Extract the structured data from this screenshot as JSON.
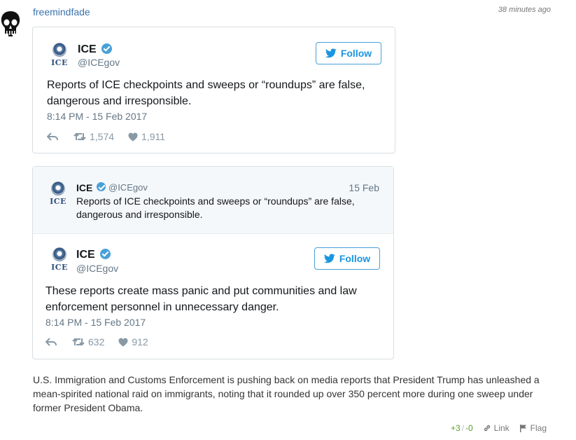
{
  "comment": {
    "username": "freemindfade",
    "timestamp": "38 minutes ago",
    "body": "U.S. Immigration and Customs Enforcement is pushing back on media reports that President Trump has unleashed a mean-spirited national raid on immigrants, noting that it rounded up over 350 percent more during one sweep under former President Obama.",
    "votes_up": "+3",
    "votes_sep": "/",
    "votes_down": "-0",
    "link_label": "Link",
    "flag_label": "Flag"
  },
  "tweet1": {
    "seal_label": "ICE",
    "name": "ICE",
    "handle": "@ICEgov",
    "follow_label": "Follow",
    "text": "Reports of ICE checkpoints and sweeps or “roundups” are false, dangerous and irresponsible.",
    "time": "8:14 PM - 15 Feb 2017",
    "retweets": "1,574",
    "likes": "1,911"
  },
  "tweet2": {
    "quoted": {
      "seal_label": "ICE",
      "name": "ICE",
      "handle": "@ICEgov",
      "date": "15 Feb",
      "text": "Reports of ICE checkpoints and sweeps or “roundups” are false, dangerous and irresponsible."
    },
    "seal_label": "ICE",
    "name": "ICE",
    "handle": "@ICEgov",
    "follow_label": "Follow",
    "text": "These reports create mass panic and put communities and law enforcement personnel in unnecessary danger.",
    "time": "8:14 PM - 15 Feb 2017",
    "retweets": "632",
    "likes": "912"
  },
  "icons": [
    "skull-avatar-icon",
    "ice-seal-icon",
    "verified-badge-icon",
    "twitter-bird-icon",
    "reply-icon",
    "retweet-icon",
    "heart-icon",
    "link-icon",
    "flag-icon"
  ],
  "colors": {
    "username": "#3b73af",
    "twitter_blue": "#1b95e0",
    "vote_green": "#5aa02c"
  }
}
